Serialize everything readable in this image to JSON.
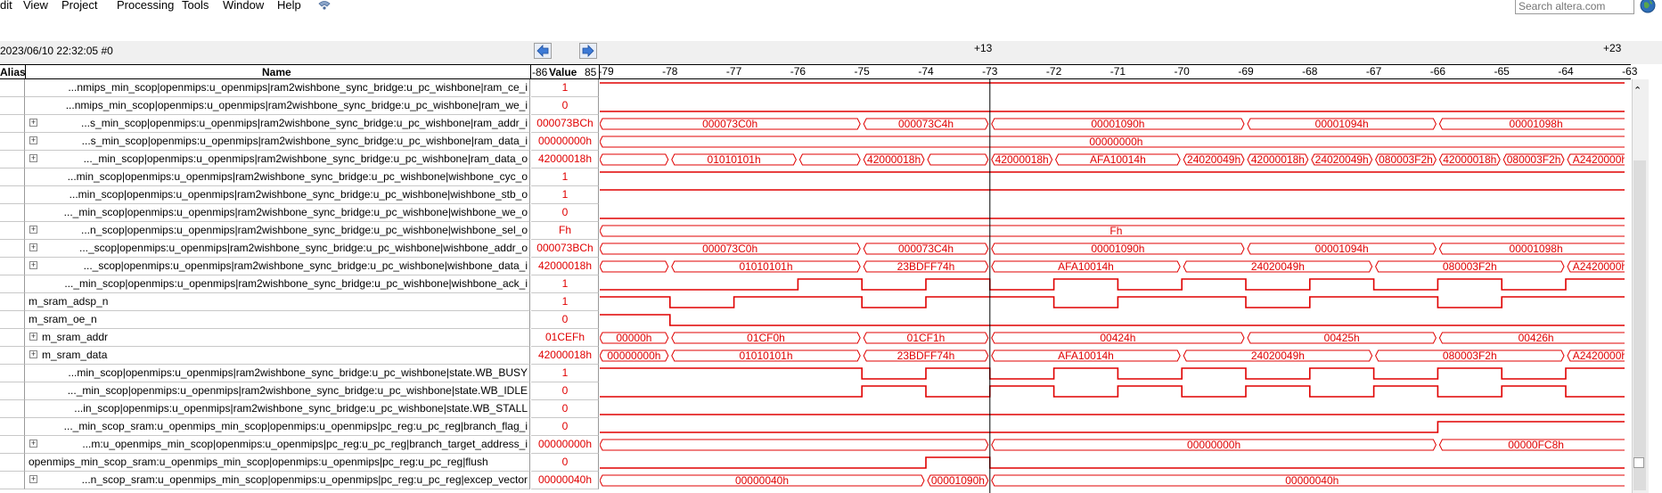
{
  "menu": [
    "dit",
    "View",
    "Project",
    "Processing",
    "Tools",
    "Window",
    "Help"
  ],
  "search": {
    "placeholder": "Search altera.com"
  },
  "header": {
    "timestamp": "2023/06/10 22:32:05  #0",
    "marker_left": "+13",
    "marker_right": "+23",
    "col_alias": "Alias",
    "col_name": "Name",
    "col_value_left": "-86",
    "col_value": "Value",
    "col_value_right": "85"
  },
  "ticks": [
    "-79",
    "-78",
    "-77",
    "-76",
    "-75",
    "-74",
    "-73",
    "-72",
    "-71",
    "-70",
    "-69",
    "-68",
    "-67",
    "-66",
    "-65",
    "-64",
    "-63"
  ],
  "colors": {
    "wave": "#e00000",
    "cursor": "#000000"
  },
  "signals": [
    {
      "name": "...nmips_min_scop|openmips:u_openmips|ram2wishbone_sync_bridge:u_pc_wishbone|ram_ce_i",
      "value": "1",
      "type": "bit",
      "expandable": false,
      "wave": {
        "init": 1,
        "edges": []
      }
    },
    {
      "name": "...nmips_min_scop|openmips:u_openmips|ram2wishbone_sync_bridge:u_pc_wishbone|ram_we_i",
      "value": "0",
      "type": "bit",
      "expandable": false,
      "wave": {
        "init": 0,
        "edges": []
      }
    },
    {
      "name": "...s_min_scop|openmips:u_openmips|ram2wishbone_sync_bridge:u_pc_wishbone|ram_addr_i",
      "value": "000073BCh",
      "type": "bus",
      "expandable": true,
      "segments": [
        {
          "s": 0,
          "e": 4,
          "l": "000073C0h"
        },
        {
          "s": 4,
          "e": 6,
          "l": "000073C4h"
        },
        {
          "s": 6,
          "e": 10,
          "l": "00001090h"
        },
        {
          "s": 10,
          "e": 13,
          "l": "00001094h"
        },
        {
          "s": 13,
          "e": 16,
          "l": "00001098h"
        }
      ]
    },
    {
      "name": "...s_min_scop|openmips:u_openmips|ram2wishbone_sync_bridge:u_pc_wishbone|ram_data_i",
      "value": "00000000h",
      "type": "bus",
      "expandable": true,
      "segments": [
        {
          "s": 0,
          "e": 16,
          "l": "00000000h"
        }
      ]
    },
    {
      "name": "..._min_scop|openmips:u_openmips|ram2wishbone_sync_bridge:u_pc_wishbone|ram_data_o",
      "value": "42000018h",
      "type": "bus",
      "expandable": true,
      "segments": [
        {
          "s": 0,
          "e": 1,
          "l": ""
        },
        {
          "s": 1,
          "e": 3,
          "l": "01010101h"
        },
        {
          "s": 3,
          "e": 4,
          "l": ""
        },
        {
          "s": 4,
          "e": 5,
          "l": "42000018h"
        },
        {
          "s": 5,
          "e": 6,
          "l": ""
        },
        {
          "s": 6,
          "e": 7,
          "l": "42000018h"
        },
        {
          "s": 7,
          "e": 9,
          "l": "AFA10014h"
        },
        {
          "s": 9,
          "e": 10,
          "l": "24020049h"
        },
        {
          "s": 10,
          "e": 11,
          "l": "42000018h"
        },
        {
          "s": 11,
          "e": 12,
          "l": "24020049h"
        },
        {
          "s": 12,
          "e": 13,
          "l": "080003F2h"
        },
        {
          "s": 13,
          "e": 14,
          "l": "42000018h"
        },
        {
          "s": 14,
          "e": 15,
          "l": "080003F2h"
        },
        {
          "s": 15,
          "e": 16,
          "l": "A2420000h"
        }
      ]
    },
    {
      "name": "...min_scop|openmips:u_openmips|ram2wishbone_sync_bridge:u_pc_wishbone|wishbone_cyc_o",
      "value": "1",
      "type": "bit",
      "expandable": false,
      "wave": {
        "init": 1,
        "edges": []
      }
    },
    {
      "name": "...min_scop|openmips:u_openmips|ram2wishbone_sync_bridge:u_pc_wishbone|wishbone_stb_o",
      "value": "1",
      "type": "bit",
      "expandable": false,
      "wave": {
        "init": 1,
        "edges": []
      }
    },
    {
      "name": "..._min_scop|openmips:u_openmips|ram2wishbone_sync_bridge:u_pc_wishbone|wishbone_we_o",
      "value": "0",
      "type": "bit",
      "expandable": false,
      "wave": {
        "init": 0,
        "edges": []
      }
    },
    {
      "name": "...n_scop|openmips:u_openmips|ram2wishbone_sync_bridge:u_pc_wishbone|wishbone_sel_o",
      "value": "Fh",
      "type": "bus",
      "expandable": true,
      "segments": [
        {
          "s": 0,
          "e": 16,
          "l": "Fh"
        }
      ]
    },
    {
      "name": "..._scop|openmips:u_openmips|ram2wishbone_sync_bridge:u_pc_wishbone|wishbone_addr_o",
      "value": "000073BCh",
      "type": "bus",
      "expandable": true,
      "segments": [
        {
          "s": 0,
          "e": 4,
          "l": "000073C0h"
        },
        {
          "s": 4,
          "e": 6,
          "l": "000073C4h"
        },
        {
          "s": 6,
          "e": 10,
          "l": "00001090h"
        },
        {
          "s": 10,
          "e": 13,
          "l": "00001094h"
        },
        {
          "s": 13,
          "e": 16,
          "l": "00001098h"
        }
      ]
    },
    {
      "name": "..._scop|openmips:u_openmips|ram2wishbone_sync_bridge:u_pc_wishbone|wishbone_data_i",
      "value": "42000018h",
      "type": "bus",
      "expandable": true,
      "segments": [
        {
          "s": 0,
          "e": 1,
          "l": ""
        },
        {
          "s": 1,
          "e": 4,
          "l": "01010101h"
        },
        {
          "s": 4,
          "e": 6,
          "l": "23BDFF74h"
        },
        {
          "s": 6,
          "e": 9,
          "l": "AFA10014h"
        },
        {
          "s": 9,
          "e": 12,
          "l": "24020049h"
        },
        {
          "s": 12,
          "e": 15,
          "l": "080003F2h"
        },
        {
          "s": 15,
          "e": 16,
          "l": "A2420000h"
        }
      ]
    },
    {
      "name": "..._min_scop|openmips:u_openmips|ram2wishbone_sync_bridge:u_pc_wishbone|wishbone_ack_i",
      "value": "1",
      "type": "bit",
      "expandable": false,
      "wave": {
        "init": 0,
        "edges": [
          3,
          4,
          5,
          6,
          7,
          8,
          9,
          10,
          11,
          12,
          13,
          14,
          15
        ]
      }
    },
    {
      "name": "m_sram_adsp_n",
      "value": "1",
      "type": "bit",
      "expandable": false,
      "wave": {
        "init": 1,
        "edges": [
          1,
          2,
          4,
          5,
          7,
          8,
          10,
          11,
          13,
          14
        ]
      }
    },
    {
      "name": "m_sram_oe_n",
      "value": "0",
      "type": "bit",
      "expandable": false,
      "wave": {
        "init": 1,
        "edges": [
          1
        ]
      }
    },
    {
      "name": "m_sram_addr",
      "value": "01CEFh",
      "type": "bus",
      "expandable": true,
      "segments": [
        {
          "s": 0,
          "e": 1,
          "l": "00000h"
        },
        {
          "s": 1,
          "e": 4,
          "l": "01CF0h"
        },
        {
          "s": 4,
          "e": 6,
          "l": "01CF1h"
        },
        {
          "s": 6,
          "e": 10,
          "l": "00424h"
        },
        {
          "s": 10,
          "e": 13,
          "l": "00425h"
        },
        {
          "s": 13,
          "e": 16,
          "l": "00426h"
        }
      ]
    },
    {
      "name": "m_sram_data",
      "value": "42000018h",
      "type": "bus",
      "expandable": true,
      "segments": [
        {
          "s": 0,
          "e": 1,
          "l": "00000000h"
        },
        {
          "s": 1,
          "e": 4,
          "l": "01010101h"
        },
        {
          "s": 4,
          "e": 6,
          "l": "23BDFF74h"
        },
        {
          "s": 6,
          "e": 9,
          "l": "AFA10014h"
        },
        {
          "s": 9,
          "e": 12,
          "l": "24020049h"
        },
        {
          "s": 12,
          "e": 15,
          "l": "080003F2h"
        },
        {
          "s": 15,
          "e": 16,
          "l": "A2420000h"
        }
      ]
    },
    {
      "name": "...min_scop|openmips:u_openmips|ram2wishbone_sync_bridge:u_pc_wishbone|state.WB_BUSY",
      "value": "1",
      "type": "bit",
      "expandable": false,
      "wave": {
        "init": 1,
        "edges": [
          4,
          5,
          6,
          7,
          8,
          9,
          10,
          11,
          12,
          13,
          14,
          15
        ]
      }
    },
    {
      "name": "..._min_scop|openmips:u_openmips|ram2wishbone_sync_bridge:u_pc_wishbone|state.WB_IDLE",
      "value": "0",
      "type": "bit",
      "expandable": false,
      "wave": {
        "init": 0,
        "edges": [
          4,
          5,
          6,
          7,
          8,
          9,
          10,
          11,
          12,
          13,
          14,
          15
        ]
      }
    },
    {
      "name": "...in_scop|openmips:u_openmips|ram2wishbone_sync_bridge:u_pc_wishbone|state.WB_STALL",
      "value": "0",
      "type": "bit",
      "expandable": false,
      "wave": {
        "init": 0,
        "edges": []
      }
    },
    {
      "name": "..._min_scop_sram:u_openmips_min_scop|openmips:u_openmips|pc_reg:u_pc_reg|branch_flag_i",
      "value": "0",
      "type": "bit",
      "expandable": false,
      "wave": {
        "init": 0,
        "edges": [
          13
        ]
      }
    },
    {
      "name": "...m:u_openmips_min_scop|openmips:u_openmips|pc_reg:u_pc_reg|branch_target_address_i",
      "value": "00000000h",
      "type": "bus",
      "expandable": true,
      "segments": [
        {
          "s": 0,
          "e": 6,
          "l": ""
        },
        {
          "s": 6,
          "e": 13,
          "l": "00000000h"
        },
        {
          "s": 13,
          "e": 16,
          "l": "00000FC8h"
        }
      ]
    },
    {
      "name": "openmips_min_scop_sram:u_openmips_min_scop|openmips:u_openmips|pc_reg:u_pc_reg|flush",
      "value": "0",
      "type": "bit",
      "expandable": false,
      "wave": {
        "init": 0,
        "edges": [
          5,
          6
        ]
      }
    },
    {
      "name": "...n_scop_sram:u_openmips_min_scop|openmips:u_openmips|pc_reg:u_pc_reg|excep_vector",
      "value": "00000040h",
      "type": "bus",
      "expandable": true,
      "segments": [
        {
          "s": 0,
          "e": 5,
          "l": "00000040h"
        },
        {
          "s": 5,
          "e": 6,
          "l": "00001090h"
        },
        {
          "s": 6,
          "e": 16,
          "l": "00000040h"
        }
      ]
    }
  ]
}
